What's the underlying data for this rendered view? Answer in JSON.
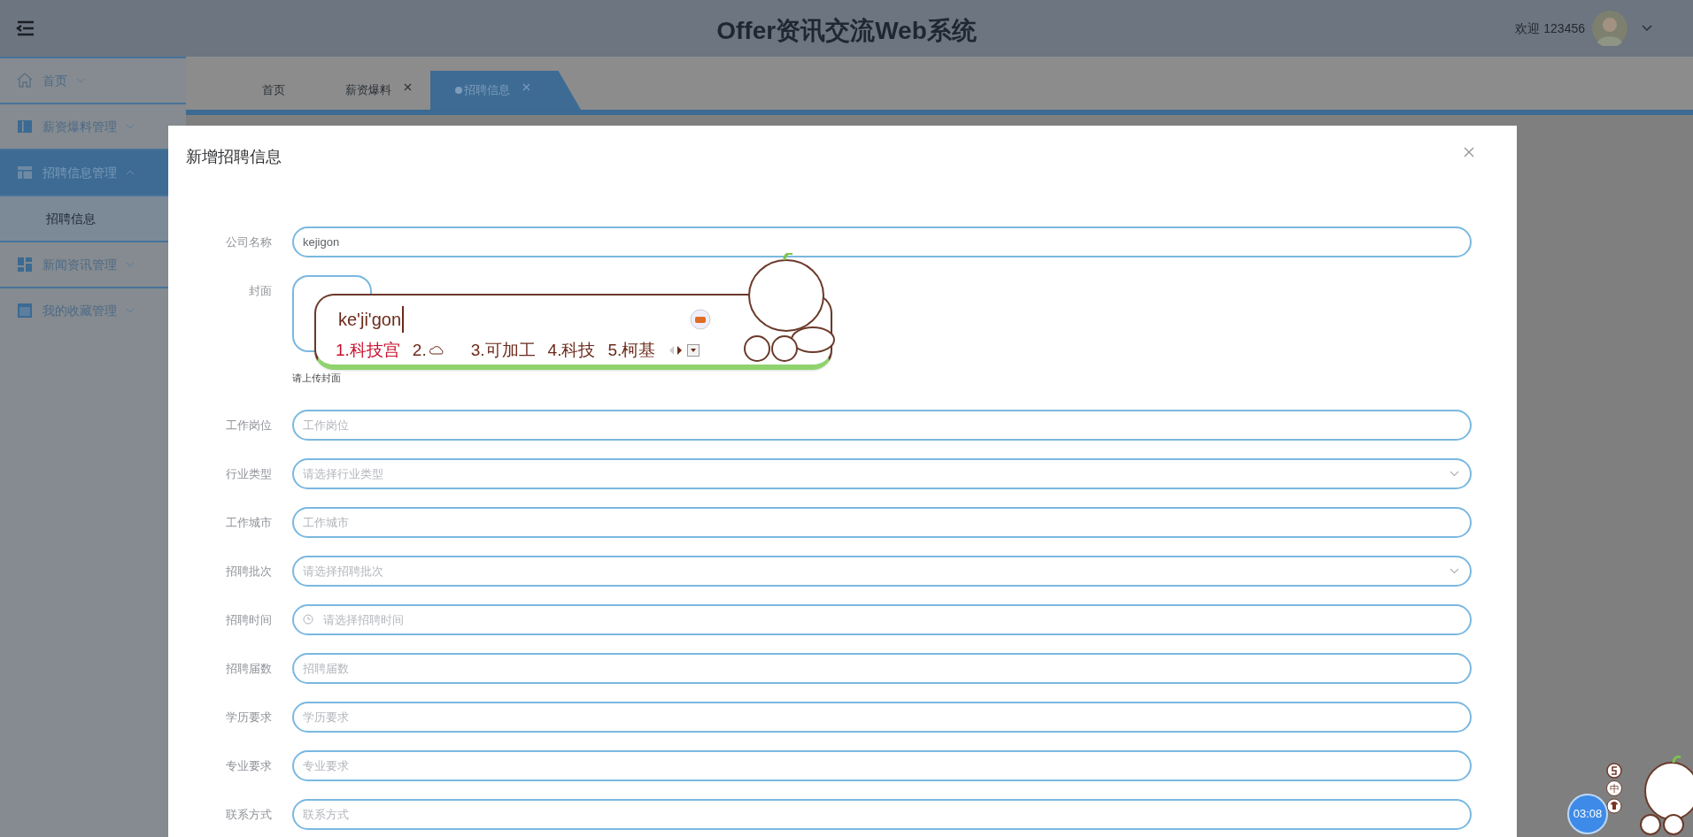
{
  "header": {
    "title": "Offer资讯交流Web系统",
    "welcome": "欢迎 123456"
  },
  "sidebar": {
    "items": [
      {
        "label": "首页",
        "expanded": false,
        "selected": false
      },
      {
        "label": "薪资爆料管理",
        "expanded": false,
        "selected": false
      },
      {
        "label": "招聘信息管理",
        "expanded": true,
        "selected": true,
        "children": [
          {
            "label": "招聘信息"
          }
        ]
      },
      {
        "label": "新闻资讯管理",
        "expanded": false,
        "selected": false
      },
      {
        "label": "我的收藏管理",
        "expanded": false,
        "selected": false
      }
    ]
  },
  "tabs": [
    {
      "label": "首页",
      "closable": false,
      "selected": false
    },
    {
      "label": "薪资爆料",
      "closable": true,
      "selected": false
    },
    {
      "label": "招聘信息",
      "closable": true,
      "selected": true
    }
  ],
  "dialog": {
    "title": "新增招聘信息",
    "fields": [
      {
        "label": "公司名称",
        "kind": "text",
        "value": "kejigon"
      },
      {
        "label": "封面",
        "kind": "upload",
        "hint": "请上传封面"
      },
      {
        "label": "工作岗位",
        "kind": "text",
        "placeholder": "工作岗位"
      },
      {
        "label": "行业类型",
        "kind": "select",
        "placeholder": "请选择行业类型"
      },
      {
        "label": "工作城市",
        "kind": "text",
        "placeholder": "工作城市"
      },
      {
        "label": "招聘批次",
        "kind": "select",
        "placeholder": "请选择招聘批次"
      },
      {
        "label": "招聘时间",
        "kind": "date",
        "placeholder": "请选择招聘时间"
      },
      {
        "label": "招聘届数",
        "kind": "text",
        "placeholder": "招聘届数"
      },
      {
        "label": "学历要求",
        "kind": "text",
        "placeholder": "学历要求"
      },
      {
        "label": "专业要求",
        "kind": "text",
        "placeholder": "专业要求"
      },
      {
        "label": "联系方式",
        "kind": "text",
        "placeholder": "联系方式"
      }
    ]
  },
  "ime": {
    "composition": "ke'ji'gon",
    "candidates": [
      {
        "label": "1.科技宫",
        "selected": true
      },
      {
        "label": "2.",
        "selected": false
      },
      {
        "label": "3.可加工",
        "selected": false
      },
      {
        "label": "4.科技",
        "selected": false
      },
      {
        "label": "5.柯基",
        "selected": false
      }
    ]
  },
  "ime_status": {
    "mode": "中",
    "timer": "03:08"
  }
}
